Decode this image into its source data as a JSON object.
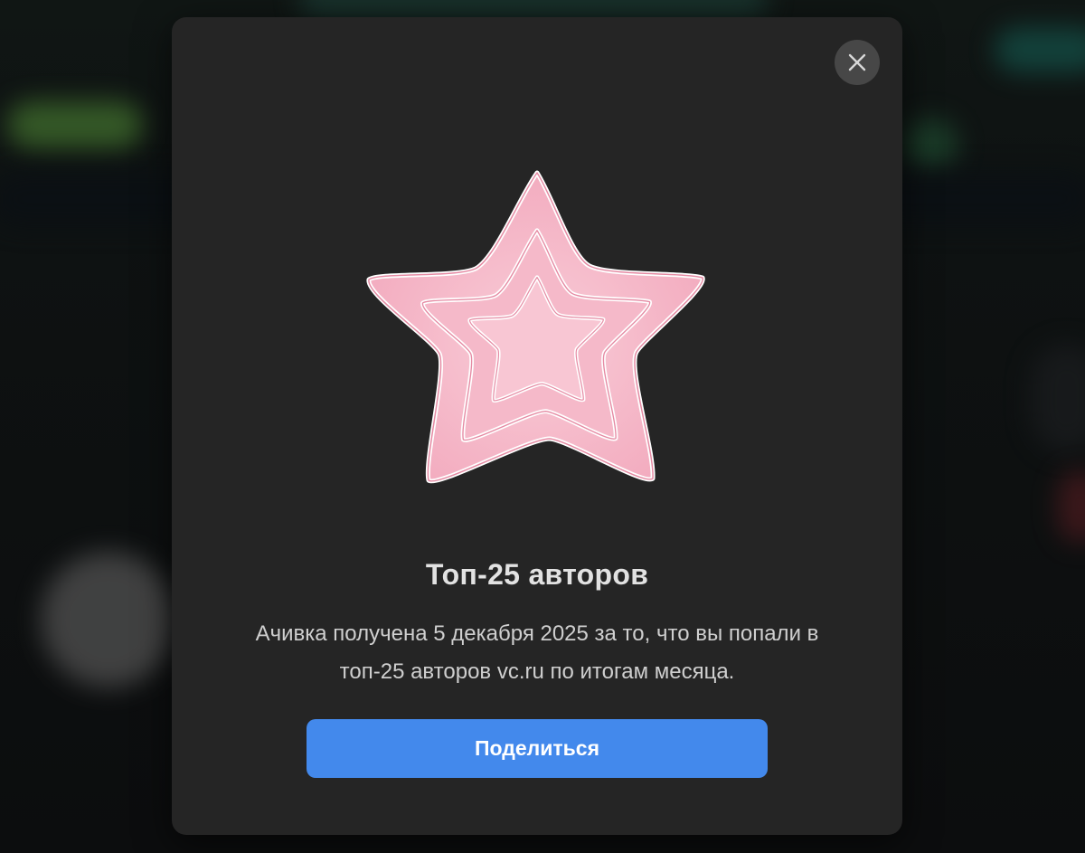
{
  "modal": {
    "title": "Топ-25 авторов",
    "description": "Ачивка получена 5 декабря 2025 за то, что вы попали в топ-25 авторов vc.ru по итогам месяца.",
    "share_label": "Поделиться",
    "close_icon": "close-icon",
    "badge_icon": "star-badge-icon"
  },
  "colors": {
    "modal_bg": "#252525",
    "accent_button": "#4389ec",
    "star_fill": "#f4b6c6",
    "star_outline": "#e58aa3"
  }
}
